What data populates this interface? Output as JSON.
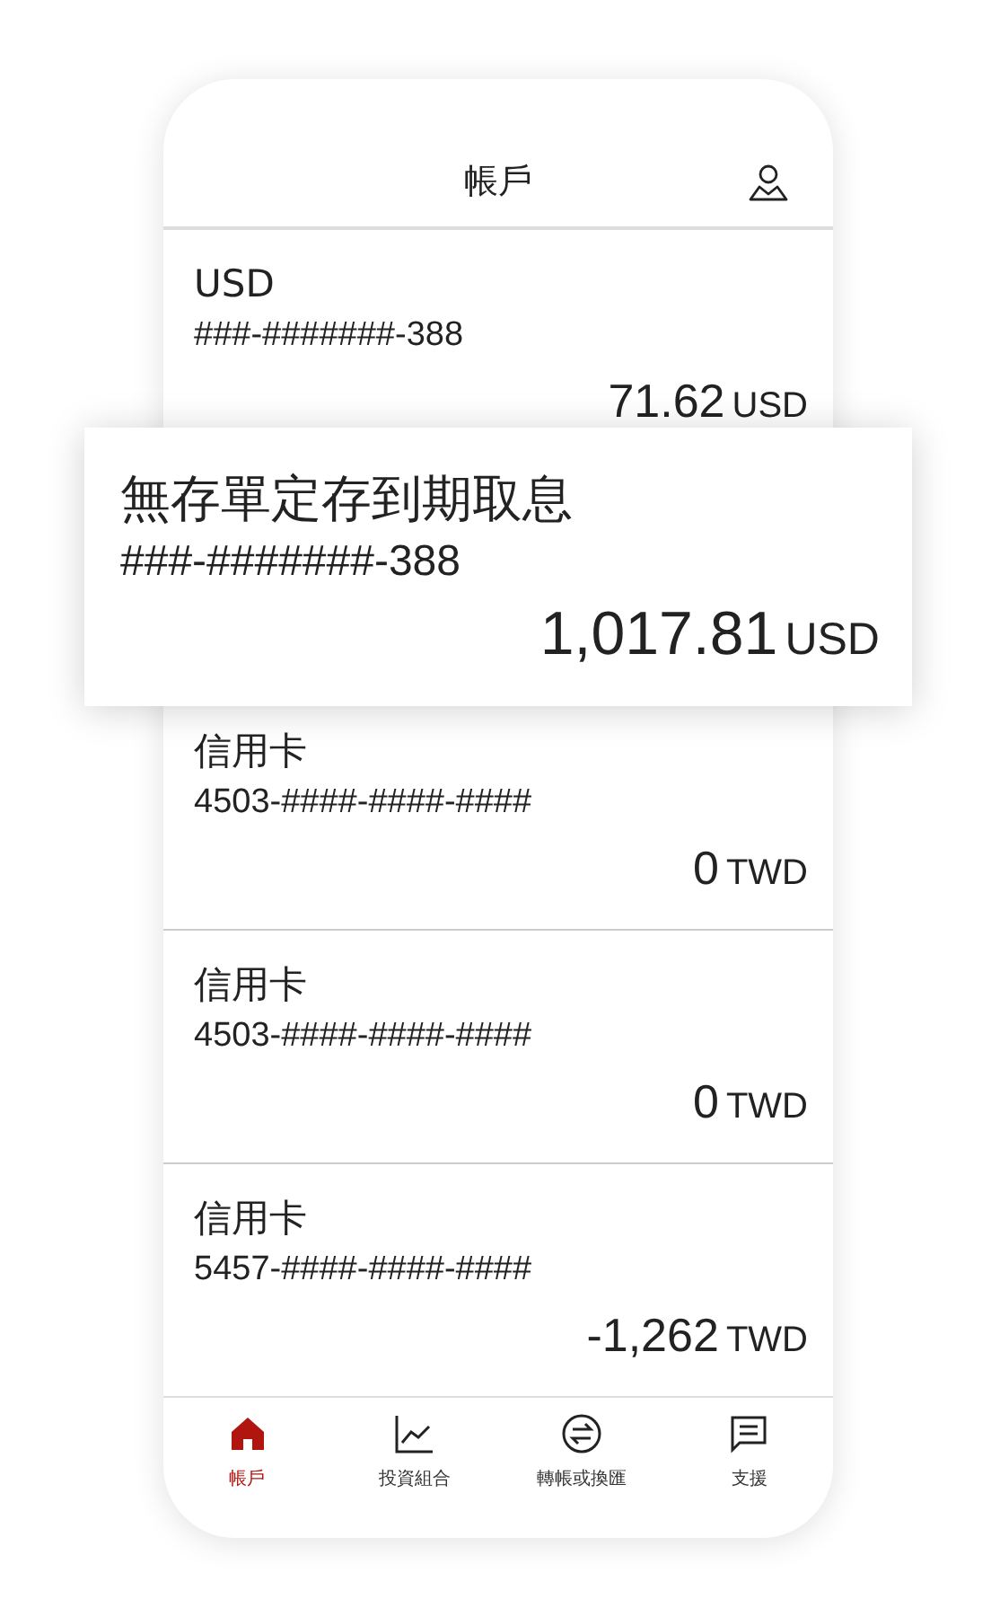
{
  "header": {
    "title": "帳戶"
  },
  "accounts": [
    {
      "name": "USD",
      "number": "###-#######-388",
      "amount": "71.62",
      "currency": "USD"
    },
    {
      "name": "信用卡",
      "number": "4503-####-####-####",
      "amount": "0",
      "currency": "TWD"
    },
    {
      "name": "信用卡",
      "number": "4503-####-####-####",
      "amount": "0",
      "currency": "TWD"
    },
    {
      "name": "信用卡",
      "number": "5457-####-####-####",
      "amount": "-1,262",
      "currency": "TWD"
    }
  ],
  "highlight": {
    "name": "無存單定存到期取息",
    "number": "###-#######-388",
    "amount": "1,017.81",
    "currency": "USD"
  },
  "tabs": [
    {
      "label": "帳戶",
      "kind": "home",
      "selected": true
    },
    {
      "label": "投資組合",
      "kind": "chart",
      "selected": false
    },
    {
      "label": "轉帳或換匯",
      "kind": "exchange",
      "selected": false
    },
    {
      "label": "支援",
      "kind": "chat",
      "selected": false
    }
  ]
}
